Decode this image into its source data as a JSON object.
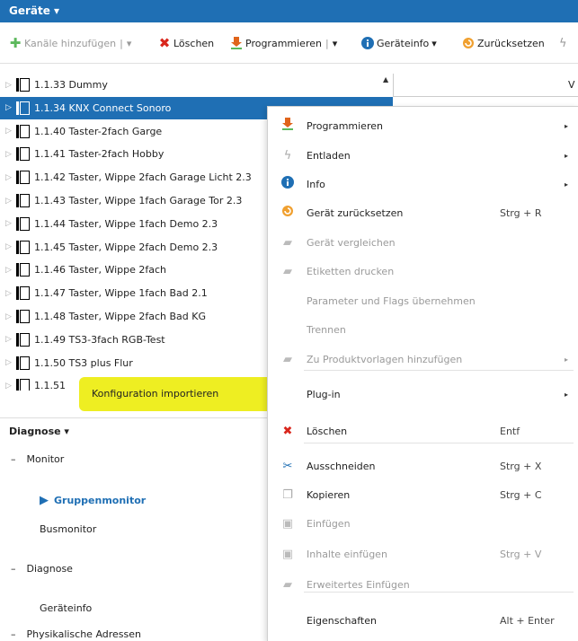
{
  "header": {
    "title": "Geräte ▾"
  },
  "toolbar": {
    "add_channels": "Kanäle hinzufügen",
    "delete": "Löschen",
    "program": "Programmieren",
    "device_info": "Geräteinfo",
    "reset": "Zurücksetzen",
    "dropdown_glyph": "▾",
    "separator": "|"
  },
  "tree": {
    "rows": [
      {
        "label": "1.1.33 Dummy"
      },
      {
        "label": "1.1.34 KNX Connect Sonoro",
        "selected": true
      },
      {
        "label": "1.1.40 Taster-2fach Garge"
      },
      {
        "label": "1.1.41 Taster-2fach Hobby"
      },
      {
        "label": "1.1.42 Taster, Wippe 2fach Garage Licht 2.3"
      },
      {
        "label": "1.1.43 Taster, Wippe 1fach Garage Tor 2.3"
      },
      {
        "label": "1.1.44 Taster, Wippe 1fach Demo 2.3"
      },
      {
        "label": "1.1.45 Taster, Wippe 2fach Demo 2.3"
      },
      {
        "label": "1.1.46 Taster, Wippe 2fach"
      },
      {
        "label": "1.1.47 Taster, Wippe 1fach Bad 2.1"
      },
      {
        "label": "1.1.48 Taster, Wippe 2fach Bad KG"
      },
      {
        "label": "1.1.49 TS3-3fach RGB-Test"
      },
      {
        "label": "1.1.50 TS3 plus Flur"
      },
      {
        "label": "1.1.51"
      }
    ],
    "right_col_text": "V"
  },
  "submenu": {
    "import_config": "Konfiguration importieren"
  },
  "diagnose": {
    "header": "Diagnose ▾",
    "monitor": "Monitor",
    "group_monitor": "Gruppenmonitor",
    "bus_monitor": "Busmonitor",
    "diagnose": "Diagnose",
    "device_info": "Geräteinfo",
    "phys_addr": "Physikalische Adressen",
    "collapse_glyph": "–"
  },
  "menu": {
    "items": [
      {
        "label": "Programmieren",
        "shortcut": "",
        "arrow": true
      },
      {
        "label": "Entladen",
        "shortcut": "",
        "arrow": true
      },
      {
        "label": "Info",
        "shortcut": "",
        "arrow": true
      },
      {
        "label": "Gerät zurücksetzen",
        "shortcut": "Strg + R"
      },
      {
        "label": "Gerät vergleichen",
        "disabled": true
      },
      {
        "label": "Etiketten drucken",
        "disabled": true
      },
      {
        "label": "Parameter und Flags übernehmen",
        "disabled": true
      },
      {
        "label": "Trennen",
        "disabled": true
      },
      {
        "label": "Zu Produktvorlagen hinzufügen",
        "disabled": true,
        "arrow": true
      },
      {
        "label": "Plug-in",
        "arrow": true
      },
      {
        "label": "Löschen",
        "shortcut": "Entf"
      },
      {
        "label": "Ausschneiden",
        "shortcut": "Strg + X"
      },
      {
        "label": "Kopieren",
        "shortcut": "Strg + C"
      },
      {
        "label": "Einfügen",
        "disabled": true
      },
      {
        "label": "Inhalte einfügen",
        "shortcut": "Strg + V",
        "disabled": true
      },
      {
        "label": "Erweitertes Einfügen",
        "disabled": true
      },
      {
        "label": "Eigenschaften",
        "shortcut": "Alt + Enter"
      }
    ],
    "arrow_glyph": "▸"
  },
  "colors": {
    "accent": "#1f6fb4",
    "highlight": "#eeee22",
    "delete_red": "#d9261c",
    "program_orange": "#e0641b"
  }
}
